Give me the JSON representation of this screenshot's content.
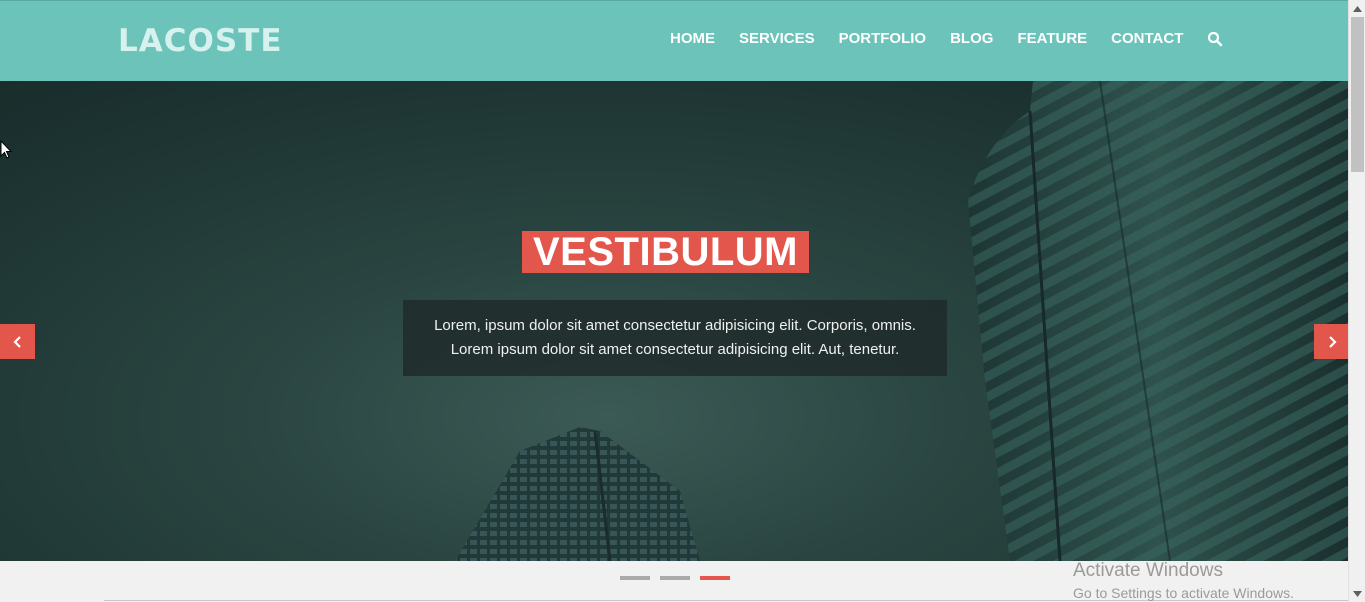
{
  "brand": {
    "logo": "LACOSTE"
  },
  "nav": {
    "items": [
      "HOME",
      "SERVICES",
      "PORTFOLIO",
      "BLOG",
      "FEATURE",
      "CONTACT"
    ],
    "search_icon": "search-icon"
  },
  "hero": {
    "title": "VESTIBULUM",
    "lines": [
      "Lorem, ipsum dolor sit amet consectetur adipisicing elit. Corporis, omnis.",
      "Lorem ipsum dolor sit amet consectetur adipisicing elit. Aut, tenetur."
    ],
    "prev_icon": "chevron-left-icon",
    "next_icon": "chevron-right-icon"
  },
  "slider": {
    "slides": 3,
    "active_index": 2
  },
  "watermark": {
    "line1": "Activate Windows",
    "line2": "Go to Settings to activate Windows."
  },
  "colors": {
    "header": "#6cc3ba",
    "accent": "#e2564c",
    "logo": "#d6f1ee"
  }
}
